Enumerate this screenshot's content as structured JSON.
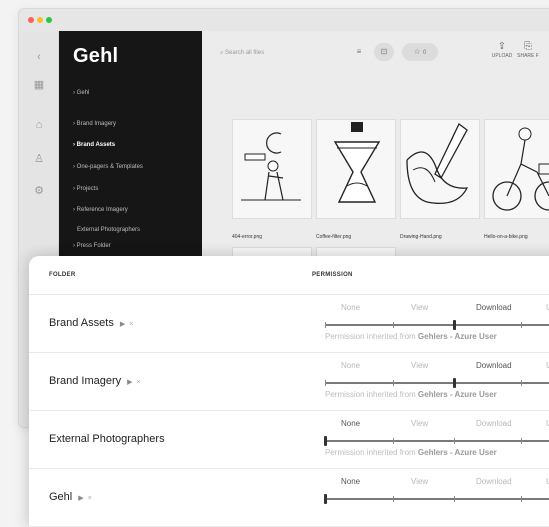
{
  "app": {
    "brand": "Gehl",
    "search_placeholder": "Search all files",
    "toolbar": {
      "upload_label": "UPLOAD",
      "share_label": "SHARE F",
      "star_count": "0"
    },
    "nav": [
      {
        "label": "Gehl",
        "active": false,
        "sub": false
      },
      {
        "label": "Brand Imagery",
        "active": false,
        "sub": false
      },
      {
        "label": "Brand Assets",
        "active": true,
        "sub": false
      },
      {
        "label": "One-pagers & Templates",
        "active": false,
        "sub": false
      },
      {
        "label": "Projects",
        "active": false,
        "sub": false
      },
      {
        "label": "Reference Imagery",
        "active": false,
        "sub": false
      },
      {
        "label": "External Photographers",
        "active": false,
        "sub": true
      },
      {
        "label": "Press Folder",
        "active": false,
        "sub": false
      }
    ],
    "thumbnails": [
      {
        "label": "404-error.png"
      },
      {
        "label": "Coffee-filter.png"
      },
      {
        "label": "Drawing-Hand.png"
      },
      {
        "label": "Hello-on-a-bike.png"
      }
    ]
  },
  "permissions": {
    "headers": {
      "folder": "FOLDER",
      "permission": "PERMISSION"
    },
    "levels": [
      "None",
      "View",
      "Download",
      "Upload"
    ],
    "inherit_prefix": "Permission inherited from",
    "inherit_source": "Gehlers - Azure User",
    "rows": [
      {
        "folder": "Brand Assets",
        "has_children": true,
        "level": "Download",
        "level_index": 2,
        "inherited": true
      },
      {
        "folder": "Brand Imagery",
        "has_children": true,
        "level": "Download",
        "level_index": 2,
        "inherited": true
      },
      {
        "folder": "External Photographers",
        "has_children": false,
        "level": "None",
        "level_index": 0,
        "inherited": true
      },
      {
        "folder": "Gehl",
        "has_children": true,
        "level": "None",
        "level_index": 0,
        "inherited": false
      }
    ]
  },
  "colors": {
    "sidebar": "#161616",
    "accent": "#333333"
  }
}
